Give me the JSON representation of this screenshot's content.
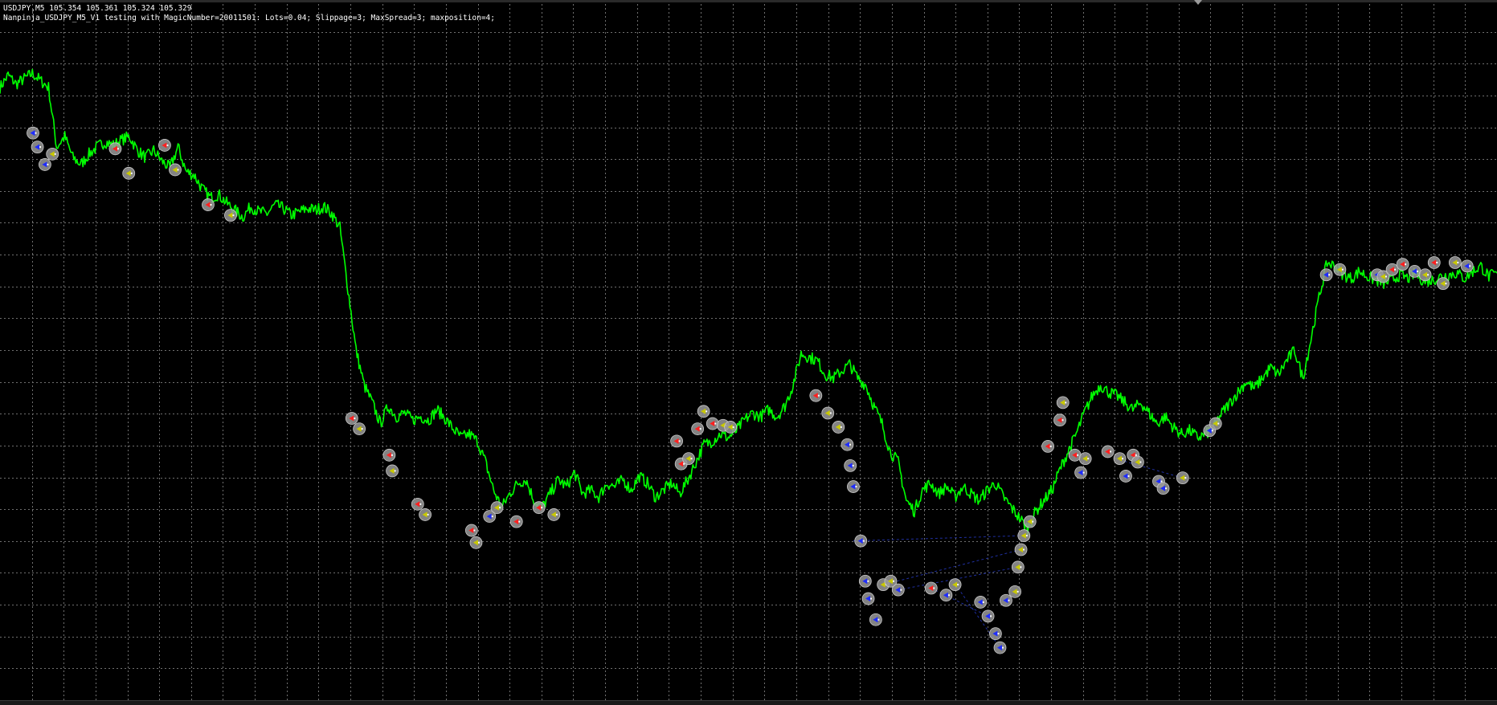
{
  "window": {
    "symbol_line": "USDJPY,M5  105.354 105.361 105.324 105.329",
    "ea_line": "Nanpinja_USDJPY_M5_V1 testing with MagicNumber=20011501: Lots=0.04; Slippage=3; MaxSpread=3; maxposition=4;"
  },
  "colors": {
    "background": "#000000",
    "grid": "#6f6f6f",
    "price": "#00ff00",
    "buy_marker": "#1e2cff",
    "sell_marker": "#ff2020",
    "close_marker": "#c8c800",
    "marker_ring": "#9a9a9a",
    "link_line": "#1f2fa0"
  },
  "chart_data": {
    "type": "line",
    "symbol": "USDJPY",
    "timeframe": "M5",
    "grid": true,
    "grid_cols": 47,
    "grid_rows": 22,
    "series": [
      {
        "values": [
          106.1,
          106.17,
          106.12,
          106.15,
          106.18,
          106.14,
          106.1,
          105.76,
          105.82,
          105.7,
          105.66,
          105.72,
          105.76,
          105.79,
          105.77,
          105.8,
          105.82,
          105.74,
          105.7,
          105.74,
          105.68,
          105.64,
          105.76,
          105.62,
          105.6,
          105.52,
          105.47,
          105.49,
          105.44,
          105.4,
          105.36,
          105.42,
          105.39,
          105.38,
          105.43,
          105.41,
          105.37,
          105.39,
          105.41,
          105.4,
          105.42,
          105.38,
          105.3,
          104.95,
          104.6,
          104.4,
          104.3,
          104.18,
          104.28,
          104.22,
          104.24,
          104.2,
          104.22,
          104.2,
          104.26,
          104.21,
          104.15,
          104.1,
          104.12,
          104.08,
          103.96,
          103.8,
          103.7,
          103.78,
          103.84,
          103.86,
          103.74,
          103.7,
          103.78,
          103.86,
          103.82,
          103.9,
          103.78,
          103.8,
          103.76,
          103.84,
          103.82,
          103.86,
          103.8,
          103.88,
          103.84,
          103.76,
          103.8,
          103.84,
          103.78,
          103.86,
          103.96,
          104.06,
          104.08,
          104.12,
          104.1,
          104.14,
          104.2,
          104.24,
          104.22,
          104.26,
          104.22,
          104.28,
          104.4,
          104.58,
          104.56,
          104.54,
          104.46,
          104.44,
          104.48,
          104.52,
          104.44,
          104.4,
          104.28,
          104.18,
          104.02,
          103.96,
          103.74,
          103.68,
          103.8,
          103.84,
          103.78,
          103.82,
          103.76,
          103.82,
          103.78,
          103.74,
          103.8,
          103.84,
          103.76,
          103.7,
          103.64,
          103.58,
          103.68,
          103.74,
          103.8,
          103.92,
          104.02,
          104.12,
          104.24,
          104.34,
          104.4,
          104.36,
          104.34,
          104.3,
          104.26,
          104.3,
          104.24,
          104.18,
          104.22,
          104.16,
          104.12,
          104.14,
          104.1,
          104.12,
          104.16,
          104.24,
          104.3,
          104.36,
          104.42,
          104.38,
          104.44,
          104.5,
          104.46,
          104.54,
          104.6,
          104.44,
          104.66,
          104.9,
          105.1,
          105.08,
          105.03,
          105.01,
          105.05,
          105.02,
          105.0,
          104.98,
          105.0,
          105.03,
          105.01,
          105.04,
          104.99,
          105.0,
          105.02,
          105.03,
          105.04,
          105.01,
          105.05,
          105.08,
          105.02,
          105.04
        ]
      }
    ],
    "trade_markers": [
      {
        "t": 0.022,
        "p": 105.84,
        "side": "buy"
      },
      {
        "t": 0.025,
        "p": 105.76,
        "side": "buy"
      },
      {
        "t": 0.03,
        "p": 105.66,
        "side": "buy"
      },
      {
        "t": 0.035,
        "p": 105.72,
        "side": "close"
      },
      {
        "t": 0.077,
        "p": 105.75,
        "side": "sell"
      },
      {
        "t": 0.086,
        "p": 105.61,
        "side": "close"
      },
      {
        "t": 0.11,
        "p": 105.77,
        "side": "sell"
      },
      {
        "t": 0.117,
        "p": 105.63,
        "side": "close"
      },
      {
        "t": 0.139,
        "p": 105.43,
        "side": "sell"
      },
      {
        "t": 0.154,
        "p": 105.37,
        "side": "close"
      },
      {
        "t": 0.235,
        "p": 104.21,
        "side": "sell"
      },
      {
        "t": 0.24,
        "p": 104.15,
        "side": "close"
      },
      {
        "t": 0.26,
        "p": 104.0,
        "side": "sell"
      },
      {
        "t": 0.262,
        "p": 103.91,
        "side": "close"
      },
      {
        "t": 0.279,
        "p": 103.72,
        "side": "sell"
      },
      {
        "t": 0.284,
        "p": 103.66,
        "side": "close"
      },
      {
        "t": 0.315,
        "p": 103.57,
        "side": "sell"
      },
      {
        "t": 0.318,
        "p": 103.5,
        "side": "close"
      },
      {
        "t": 0.327,
        "p": 103.65,
        "side": "buy"
      },
      {
        "t": 0.332,
        "p": 103.7,
        "side": "close"
      },
      {
        "t": 0.345,
        "p": 103.62,
        "side": "sell"
      },
      {
        "t": 0.36,
        "p": 103.7,
        "side": "sell"
      },
      {
        "t": 0.37,
        "p": 103.66,
        "side": "close"
      },
      {
        "t": 0.452,
        "p": 104.08,
        "side": "sell"
      },
      {
        "t": 0.455,
        "p": 103.95,
        "side": "sell"
      },
      {
        "t": 0.46,
        "p": 103.98,
        "side": "close"
      },
      {
        "t": 0.466,
        "p": 104.15,
        "side": "sell"
      },
      {
        "t": 0.47,
        "p": 104.25,
        "side": "close"
      },
      {
        "t": 0.476,
        "p": 104.18,
        "side": "sell"
      },
      {
        "t": 0.483,
        "p": 104.17,
        "side": "close"
      },
      {
        "t": 0.488,
        "p": 104.16,
        "side": "close"
      },
      {
        "t": 0.545,
        "p": 104.34,
        "side": "sell"
      },
      {
        "t": 0.553,
        "p": 104.24,
        "side": "close"
      },
      {
        "t": 0.56,
        "p": 104.16,
        "side": "close"
      },
      {
        "t": 0.566,
        "p": 104.06,
        "side": "buy"
      },
      {
        "t": 0.568,
        "p": 103.94,
        "side": "buy"
      },
      {
        "t": 0.57,
        "p": 103.82,
        "side": "buy"
      },
      {
        "t": 0.575,
        "p": 103.51,
        "side": "buy"
      },
      {
        "t": 0.578,
        "p": 103.28,
        "side": "buy"
      },
      {
        "t": 0.58,
        "p": 103.18,
        "side": "buy"
      },
      {
        "t": 0.585,
        "p": 103.06,
        "side": "buy"
      },
      {
        "t": 0.59,
        "p": 103.26,
        "side": "close"
      },
      {
        "t": 0.595,
        "p": 103.28,
        "side": "close"
      },
      {
        "t": 0.6,
        "p": 103.23,
        "side": "buy"
      },
      {
        "t": 0.622,
        "p": 103.24,
        "side": "sell"
      },
      {
        "t": 0.632,
        "p": 103.2,
        "side": "buy"
      },
      {
        "t": 0.638,
        "p": 103.26,
        "side": "close"
      },
      {
        "t": 0.655,
        "p": 103.16,
        "side": "buy"
      },
      {
        "t": 0.66,
        "p": 103.08,
        "side": "buy"
      },
      {
        "t": 0.665,
        "p": 102.98,
        "side": "buy"
      },
      {
        "t": 0.668,
        "p": 102.9,
        "side": "buy"
      },
      {
        "t": 0.672,
        "p": 103.17,
        "side": "buy"
      },
      {
        "t": 0.678,
        "p": 103.22,
        "side": "close"
      },
      {
        "t": 0.68,
        "p": 103.36,
        "side": "close"
      },
      {
        "t": 0.682,
        "p": 103.46,
        "side": "close"
      },
      {
        "t": 0.684,
        "p": 103.54,
        "side": "close"
      },
      {
        "t": 0.688,
        "p": 103.62,
        "side": "close"
      },
      {
        "t": 0.7,
        "p": 104.05,
        "side": "sell"
      },
      {
        "t": 0.708,
        "p": 104.2,
        "side": "sell"
      },
      {
        "t": 0.71,
        "p": 104.3,
        "side": "close"
      },
      {
        "t": 0.718,
        "p": 104.0,
        "side": "sell"
      },
      {
        "t": 0.722,
        "p": 103.9,
        "side": "buy"
      },
      {
        "t": 0.725,
        "p": 103.98,
        "side": "close"
      },
      {
        "t": 0.74,
        "p": 104.02,
        "side": "sell"
      },
      {
        "t": 0.748,
        "p": 103.98,
        "side": "close"
      },
      {
        "t": 0.752,
        "p": 103.88,
        "side": "buy"
      },
      {
        "t": 0.757,
        "p": 104.0,
        "side": "sell"
      },
      {
        "t": 0.76,
        "p": 103.96,
        "side": "close"
      },
      {
        "t": 0.774,
        "p": 103.85,
        "side": "buy"
      },
      {
        "t": 0.777,
        "p": 103.81,
        "side": "buy"
      },
      {
        "t": 0.79,
        "p": 103.87,
        "side": "close"
      },
      {
        "t": 0.808,
        "p": 104.14,
        "side": "buy"
      },
      {
        "t": 0.812,
        "p": 104.18,
        "side": "close"
      },
      {
        "t": 0.886,
        "p": 105.03,
        "side": "buy"
      },
      {
        "t": 0.895,
        "p": 105.06,
        "side": "close"
      },
      {
        "t": 0.92,
        "p": 105.03,
        "side": "buy"
      },
      {
        "t": 0.924,
        "p": 105.02,
        "side": "close"
      },
      {
        "t": 0.93,
        "p": 105.06,
        "side": "sell"
      },
      {
        "t": 0.937,
        "p": 105.09,
        "side": "sell"
      },
      {
        "t": 0.945,
        "p": 105.05,
        "side": "buy"
      },
      {
        "t": 0.952,
        "p": 105.03,
        "side": "close"
      },
      {
        "t": 0.958,
        "p": 105.1,
        "side": "sell"
      },
      {
        "t": 0.964,
        "p": 104.98,
        "side": "close"
      },
      {
        "t": 0.972,
        "p": 105.1,
        "side": "close"
      },
      {
        "t": 0.98,
        "p": 105.08,
        "side": "buy"
      }
    ],
    "link_lines": [
      {
        "from": [
          0.57,
          103.51
        ],
        "to": [
          0.684,
          103.54
        ]
      },
      {
        "from": [
          0.59,
          103.26
        ],
        "to": [
          0.682,
          103.46
        ]
      },
      {
        "from": [
          0.6,
          103.23
        ],
        "to": [
          0.68,
          103.36
        ]
      },
      {
        "from": [
          0.622,
          103.24
        ],
        "to": [
          0.66,
          103.08
        ]
      },
      {
        "from": [
          0.64,
          103.24
        ],
        "to": [
          0.668,
          102.9
        ]
      },
      {
        "from": [
          0.745,
          103.98
        ],
        "to": [
          0.79,
          103.87
        ]
      }
    ],
    "ylim": [
      102.6,
      106.6
    ]
  }
}
